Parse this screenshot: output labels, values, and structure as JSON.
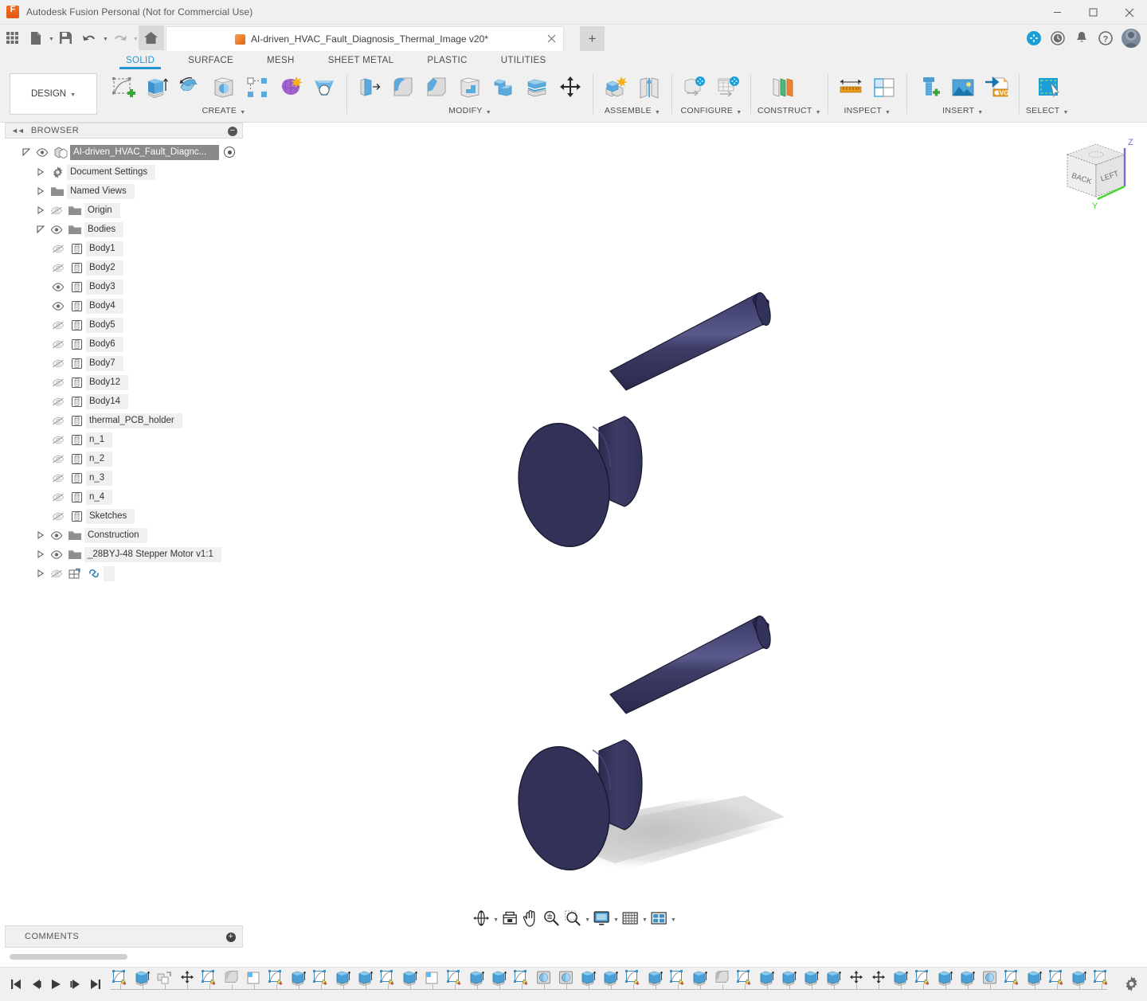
{
  "window": {
    "title": "Autodesk Fusion Personal (Not for Commercial Use)",
    "logo_icon": "fusion-logo-icon",
    "minimize_icon": "minimize-icon",
    "maximize_icon": "maximize-icon",
    "close_icon": "close-icon"
  },
  "quick_access": {
    "grid_icon": "app-grid-icon",
    "new_icon": "new-document-icon",
    "save_icon": "save-icon",
    "undo_icon": "undo-icon",
    "redo_icon": "redo-icon",
    "home_icon": "home-icon",
    "new_tab_icon": "plus-icon",
    "extension_icon": "extension-add-icon",
    "history_icon": "job-status-clock-icon",
    "notification_icon": "bell-icon",
    "help_icon": "help-question-icon",
    "avatar_icon": "user-avatar"
  },
  "document_tab": {
    "label": "AI-driven_HVAC_Fault_Diagnosis_Thermal_Image v20*",
    "cube_icon": "document-cube-icon",
    "close_icon": "close-icon"
  },
  "workspace": {
    "selector_label": "DESIGN",
    "selector_caret": "▾"
  },
  "ribbon": {
    "tabs": [
      {
        "label": "SOLID",
        "active": true
      },
      {
        "label": "SURFACE",
        "active": false
      },
      {
        "label": "MESH",
        "active": false
      },
      {
        "label": "SHEET METAL",
        "active": false
      },
      {
        "label": "PLASTIC",
        "active": false
      },
      {
        "label": "UTILITIES",
        "active": false
      }
    ],
    "panels": [
      {
        "label": "CREATE",
        "dropdown": true,
        "buttons": [
          "create-sketch-icon",
          "extrude-icon",
          "revolve-icon",
          "sweep-icon",
          "pattern-rectangular-icon",
          "form-icon",
          "loft-icon"
        ]
      },
      {
        "label": "MODIFY",
        "dropdown": true,
        "buttons": [
          "press-pull-icon",
          "fillet-icon",
          "chamfer-icon",
          "shell-icon",
          "combine-icon",
          "split-body-icon",
          "move-copy-icon"
        ]
      },
      {
        "label": "ASSEMBLE",
        "dropdown": true,
        "buttons": [
          "new-component-icon",
          "joint-icon"
        ]
      },
      {
        "label": "CONFIGURE",
        "dropdown": true,
        "buttons": [
          "configure-design-icon",
          "configure-table-icon"
        ]
      },
      {
        "label": "CONSTRUCT",
        "dropdown": true,
        "buttons": [
          "offset-plane-icon"
        ]
      },
      {
        "label": "INSPECT",
        "dropdown": true,
        "buttons": [
          "measure-icon",
          "section-analysis-icon"
        ]
      },
      {
        "label": "INSERT",
        "dropdown": true,
        "buttons": [
          "insert-mcmaster-part-icon",
          "insert-image-icon",
          "insert-svg-icon"
        ]
      },
      {
        "label": "SELECT",
        "dropdown": true,
        "buttons": [
          "select-window-icon"
        ]
      }
    ]
  },
  "browser": {
    "title": "BROWSER",
    "collapse_icon": "collapse-left-icon",
    "minimize_icon": "minus-circle-icon",
    "tree": [
      {
        "label": "AI-driven_HVAC_Fault_Diagnc...",
        "level": 0,
        "expanded": true,
        "visible": true,
        "icon": "component-icon",
        "selected": true,
        "has_target": true
      },
      {
        "label": "Document Settings",
        "level": 1,
        "expanded": false,
        "icon": "gear-icon",
        "has_eye": false
      },
      {
        "label": "Named Views",
        "level": 1,
        "expanded": false,
        "icon": "folder-icon",
        "has_eye": false
      },
      {
        "label": "Origin",
        "level": 1,
        "expanded": false,
        "icon": "folder-icon",
        "visible": false
      },
      {
        "label": "Bodies",
        "level": 1,
        "expanded": true,
        "icon": "folder-icon",
        "visible": true
      },
      {
        "label": "Body1",
        "level": 2,
        "icon": "body-icon",
        "visible": false
      },
      {
        "label": "Body2",
        "level": 2,
        "icon": "body-icon",
        "visible": false
      },
      {
        "label": "Body3",
        "level": 2,
        "icon": "body-icon",
        "visible": true
      },
      {
        "label": "Body4",
        "level": 2,
        "icon": "body-icon",
        "visible": true
      },
      {
        "label": "Body5",
        "level": 2,
        "icon": "body-icon",
        "visible": false
      },
      {
        "label": "Body6",
        "level": 2,
        "icon": "body-icon",
        "visible": false
      },
      {
        "label": "Body7",
        "level": 2,
        "icon": "body-icon",
        "visible": false
      },
      {
        "label": "Body12",
        "level": 2,
        "icon": "body-icon",
        "visible": false
      },
      {
        "label": "Body14",
        "level": 2,
        "icon": "body-icon",
        "visible": false
      },
      {
        "label": "thermal_PCB_holder",
        "level": 2,
        "icon": "body-icon",
        "visible": false
      },
      {
        "label": "n_1",
        "level": 2,
        "icon": "body-icon",
        "visible": false
      },
      {
        "label": "n_2",
        "level": 2,
        "icon": "body-icon",
        "visible": false
      },
      {
        "label": "n_3",
        "level": 2,
        "icon": "body-icon",
        "visible": false
      },
      {
        "label": "n_4",
        "level": 2,
        "icon": "body-icon",
        "visible": false
      },
      {
        "label": "Sketches",
        "level": 1,
        "expanded": false,
        "icon": "folder-icon",
        "visible": true
      },
      {
        "label": "Construction",
        "level": 1,
        "expanded": false,
        "icon": "folder-icon",
        "visible": true
      },
      {
        "label": "_28BYJ-48 Stepper Motor v1:1",
        "level": 1,
        "expanded": false,
        "icon": "component-link-icon",
        "visible": false,
        "has_link": true
      }
    ]
  },
  "comments": {
    "title": "COMMENTS",
    "add_icon": "plus-circle-icon"
  },
  "viewcube": {
    "face_left_label": "BACK",
    "face_right_label": "LEFT",
    "axis_z_label": "Z",
    "axis_y_label": "Y",
    "axis_z_color": "#7b68d6",
    "axis_y_color": "#44d62c"
  },
  "navbar": {
    "buttons": [
      {
        "icon": "orbit-icon",
        "dropdown": true
      },
      {
        "icon": "look-at-icon",
        "dropdown": false
      },
      {
        "icon": "pan-hand-icon",
        "dropdown": false
      },
      {
        "icon": "zoom-in-out-icon",
        "dropdown": false
      },
      {
        "icon": "zoom-window-icon",
        "dropdown": true
      },
      {
        "icon": "display-settings-icon",
        "dropdown": true
      },
      {
        "icon": "grid-snap-icon",
        "dropdown": true
      },
      {
        "icon": "viewport-layout-icon",
        "dropdown": true
      }
    ]
  },
  "timeline": {
    "playback": [
      "skip-to-start-icon",
      "step-back-icon",
      "play-icon",
      "step-forward-icon",
      "skip-to-end-icon"
    ],
    "features": [
      "sketch-icon",
      "extrude-icon",
      "component-icon",
      "move-icon",
      "sketch-icon",
      "chamfer-icon",
      "plane-icon",
      "sketch-icon",
      "extrude-icon",
      "sketch-icon",
      "extrude-icon",
      "extrude-icon",
      "sketch-icon",
      "extrude-icon",
      "plane-icon",
      "sketch-icon",
      "extrude-icon",
      "extrude-icon",
      "sketch-icon",
      "revolve-icon",
      "revolve-icon",
      "extrude-icon",
      "extrude-icon",
      "sketch-icon",
      "extrude-icon",
      "sketch-icon",
      "extrude-icon",
      "fillet-icon",
      "sketch-icon",
      "extrude-icon",
      "extrude-icon",
      "extrude-icon",
      "extrude-icon",
      "move-icon",
      "move-icon",
      "extrude-icon",
      "sketch-icon",
      "extrude-icon",
      "extrude-icon",
      "revolve-icon",
      "sketch-icon",
      "extrude-icon",
      "sketch-icon",
      "extrude-icon",
      "sketch-icon",
      "extrude-icon",
      "extrude-icon",
      "sketch-icon",
      "extrude-icon",
      "sketch-icon",
      "extrude-icon",
      "fillet-icon"
    ],
    "settings_icon": "gear-icon"
  },
  "model": {
    "body_color": "#323259",
    "body_highlight": "#474773",
    "body_edge": "#14142b",
    "shadow_color": "#bfbfbf",
    "bodies": [
      {
        "name": "Body3",
        "has_shadow": false
      },
      {
        "name": "Body4",
        "has_shadow": true
      }
    ]
  },
  "colors": {
    "accent": "#2196d4",
    "chrome": "#f0f0f0",
    "canvas": "#ffffff",
    "brand_orange": "#f26b21"
  }
}
